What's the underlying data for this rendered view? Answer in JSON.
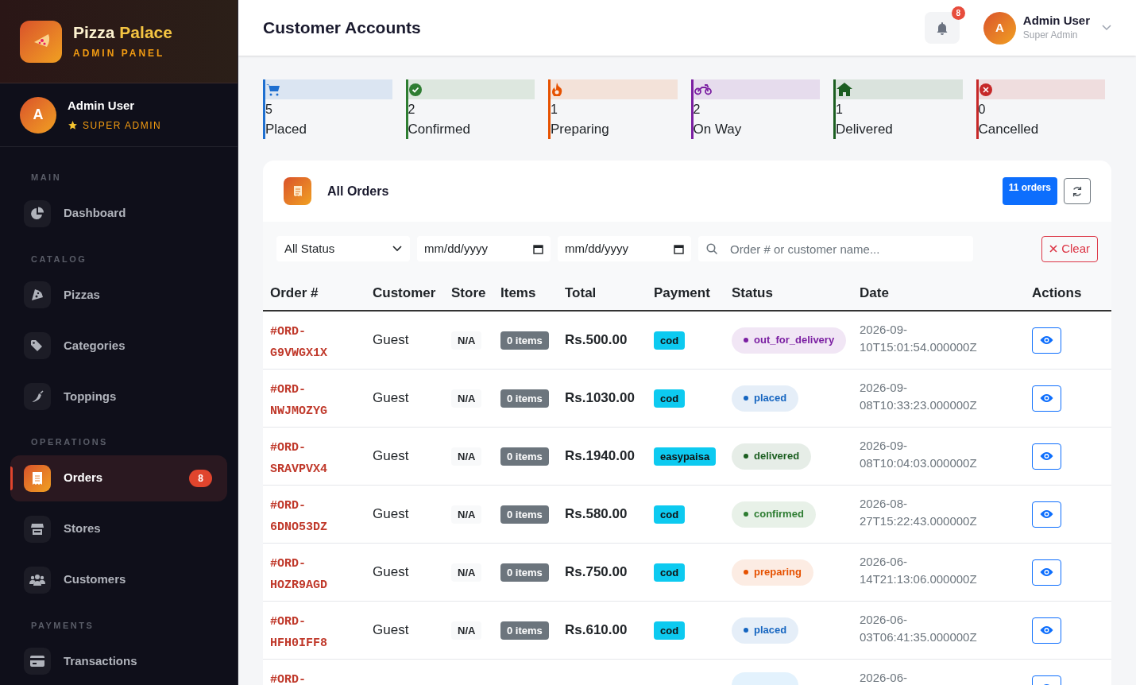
{
  "brand": {
    "name_first": "Pizza",
    "name_second": "Palace",
    "subtitle": "ADMIN PANEL"
  },
  "sidebar_user": {
    "initial": "A",
    "name": "Admin User",
    "role": "SUPER ADMIN"
  },
  "sidebar": {
    "sections": [
      {
        "heading": "MAIN",
        "items": [
          {
            "label": "Dashboard",
            "kind": "dashboard",
            "selected": false
          }
        ]
      },
      {
        "heading": "CATALOG",
        "items": [
          {
            "label": "Pizzas",
            "kind": "pizza",
            "selected": false
          },
          {
            "label": "Categories",
            "kind": "tags",
            "selected": false
          },
          {
            "label": "Toppings",
            "kind": "pepper",
            "selected": false
          }
        ]
      },
      {
        "heading": "OPERATIONS",
        "items": [
          {
            "label": "Orders",
            "kind": "receipt",
            "selected": true,
            "badge": "8"
          },
          {
            "label": "Stores",
            "kind": "store",
            "selected": false
          },
          {
            "label": "Customers",
            "kind": "users",
            "selected": false
          }
        ]
      },
      {
        "heading": "PAYMENTS",
        "items": [
          {
            "label": "Transactions",
            "kind": "card",
            "selected": false
          }
        ]
      }
    ]
  },
  "header": {
    "title": "Customer Accounts",
    "notification_count": "8",
    "user": {
      "initial": "A",
      "name": "Admin User",
      "role": "Super Admin"
    }
  },
  "stats": [
    {
      "kind": "cart",
      "count": "5",
      "label": "Placed",
      "color": "#1e6fd0"
    },
    {
      "kind": "check",
      "count": "2",
      "label": "Confirmed",
      "color": "#2e7d32"
    },
    {
      "kind": "fire",
      "count": "1",
      "label": "Preparing",
      "color": "#e65100"
    },
    {
      "kind": "bike",
      "count": "2",
      "label": "On Way",
      "color": "#7b1fa2"
    },
    {
      "kind": "home",
      "count": "1",
      "label": "Delivered",
      "color": "#1b5e20"
    },
    {
      "kind": "cancel",
      "count": "0",
      "label": "Cancelled",
      "color": "#c62828"
    }
  ],
  "orders_card": {
    "title": "All Orders",
    "count_badge": "11 orders",
    "filters": {
      "status": "All Status",
      "date_from": "mm/dd/yyyy",
      "date_to": "mm/dd/yyyy",
      "search_placeholder": "Order # or customer name...",
      "clear": "Clear"
    },
    "table": {
      "columns": [
        "Order #",
        "Customer",
        "Store",
        "Items",
        "Total",
        "Payment",
        "Status",
        "Date",
        "Actions"
      ],
      "rows": [
        {
          "order_line1": "#ORD-",
          "order_line2": "G9VWGX1X",
          "customer": "Guest",
          "store": "N/A",
          "items": "0 items",
          "total": "Rs.500.00",
          "payment": "cod",
          "status": {
            "label": "out_for_delivery",
            "color": "#7b1fa2"
          },
          "date_line1": "2026-09-",
          "date_line2": "10T15:01:54.000000Z"
        },
        {
          "order_line1": "#ORD-",
          "order_line2": "NWJMOZYG",
          "customer": "Guest",
          "store": "N/A",
          "items": "0 items",
          "total": "Rs.1030.00",
          "payment": "cod",
          "status": {
            "label": "placed",
            "color": "#1565c0"
          },
          "date_line1": "2026-09-",
          "date_line2": "08T10:33:23.000000Z"
        },
        {
          "order_line1": "#ORD-",
          "order_line2": "SRAVPVX4",
          "customer": "Guest",
          "store": "N/A",
          "items": "0 items",
          "total": "Rs.1940.00",
          "payment": "easypaisa",
          "status": {
            "label": "delivered",
            "color": "#1b5e20"
          },
          "date_line1": "2026-09-",
          "date_line2": "08T10:04:03.000000Z"
        },
        {
          "order_line1": "#ORD-",
          "order_line2": "6DNO53DZ",
          "customer": "Guest",
          "store": "N/A",
          "items": "0 items",
          "total": "Rs.580.00",
          "payment": "cod",
          "status": {
            "label": "confirmed",
            "color": "#2e7d32"
          },
          "date_line1": "2026-08-",
          "date_line2": "27T15:22:43.000000Z"
        },
        {
          "order_line1": "#ORD-",
          "order_line2": "HOZR9AGD",
          "customer": "Guest",
          "store": "N/A",
          "items": "0 items",
          "total": "Rs.750.00",
          "payment": "cod",
          "status": {
            "label": "preparing",
            "color": "#e65100"
          },
          "date_line1": "2026-06-",
          "date_line2": "14T21:13:06.000000Z"
        },
        {
          "order_line1": "#ORD-",
          "order_line2": "HFH0IFF8",
          "customer": "Guest",
          "store": "N/A",
          "items": "0 items",
          "total": "Rs.610.00",
          "payment": "cod",
          "status": {
            "label": "placed",
            "color": "#1565c0"
          },
          "date_line1": "2026-06-",
          "date_line2": "03T06:41:35.000000Z"
        },
        {
          "order_line1": "#ORD-",
          "status": {
            "color": "#e3f2fd"
          },
          "date_line1": "2026-06-"
        }
      ]
    }
  }
}
